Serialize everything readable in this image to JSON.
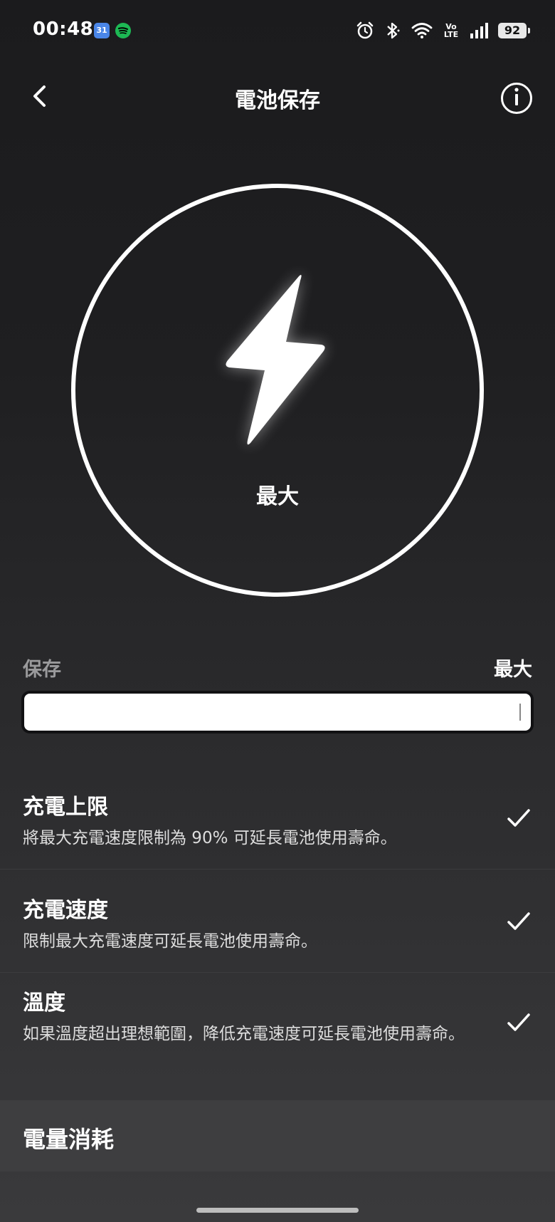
{
  "status_bar": {
    "time": "00:48",
    "calendar_day": "31",
    "network_label": "Vo LTE",
    "battery_percent": "92"
  },
  "header": {
    "title": "電池保存",
    "back_icon": "chevron-left-icon",
    "info_icon": "info-icon"
  },
  "mode": {
    "icon": "lightning-bolt-icon",
    "label": "最大"
  },
  "slider": {
    "label_left": "保存",
    "label_right": "最大",
    "level_fraction": 1.0
  },
  "options": [
    {
      "title": "充電上限",
      "description": "將最大充電速度限制為 90% 可延長電池使用壽命。",
      "checked": true
    },
    {
      "title": "充電速度",
      "description": "限制最大充電速度可延長電池使用壽命。",
      "checked": true
    },
    {
      "title": "溫度",
      "description": "如果溫度超出理想範圍，降低充電速度可延長電池使用壽命。",
      "checked": true
    }
  ],
  "power_section": {
    "title": "電量消耗"
  }
}
